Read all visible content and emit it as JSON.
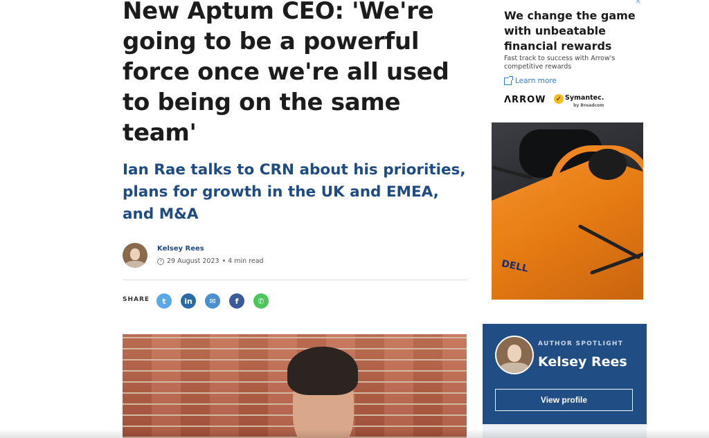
{
  "article": {
    "headline": "New Aptum CEO: 'We're going to be a powerful force once we're all used to being on the same team'",
    "standfirst": "Ian Rae talks to CRN about his priorities, plans for growth in the UK and EMEA, and M&A",
    "author": "Kelsey Rees",
    "date": "29 August 2023",
    "read_time": "• 4 min read",
    "share_label": "SHARE",
    "share_buttons": [
      {
        "name": "twitter",
        "color": "#5aa9e6",
        "glyph": "t"
      },
      {
        "name": "linkedin",
        "color": "#2b6aa6",
        "glyph": "in"
      },
      {
        "name": "email",
        "color": "#4b8fd0",
        "glyph": "✉"
      },
      {
        "name": "facebook",
        "color": "#3b5b98",
        "glyph": "f"
      },
      {
        "name": "whatsapp",
        "color": "#4ac65c",
        "glyph": "✆"
      }
    ]
  },
  "ad": {
    "close": "×",
    "headline": "We change the game with unbeatable financial rewards",
    "subtext": "Fast track to success with Arrow's competitive rewards",
    "cta": "Learn more",
    "logo_arrow": "ΛRROW",
    "logo_symantec": "Symantec.",
    "logo_symantec_by": "by Broadcom",
    "check": "✓"
  },
  "spotlight": {
    "kicker": "AUTHOR SPOTLIGHT",
    "name": "Kelsey Rees",
    "button": "View profile"
  },
  "f1_livery": "DELL"
}
